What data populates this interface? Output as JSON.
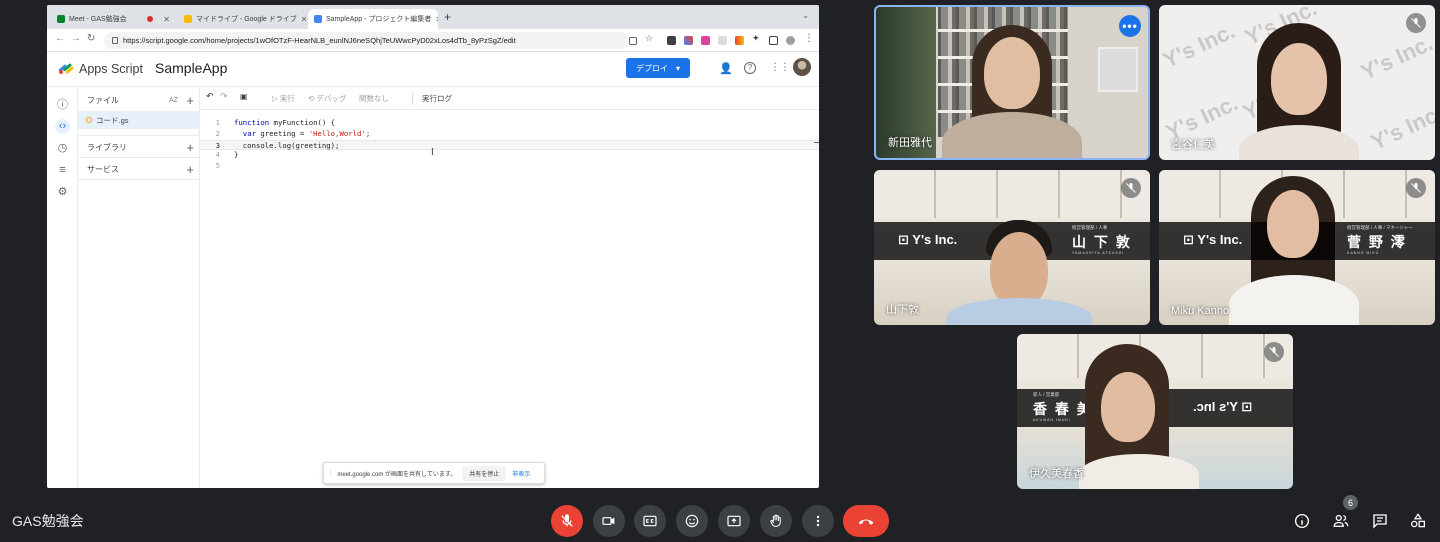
{
  "browser": {
    "tabs": [
      {
        "title": "Meet - GAS勉強会",
        "color": "#00832d"
      },
      {
        "title": "マイドライブ - Google ドライブ",
        "color": "#fbbc04"
      },
      {
        "title": "SampleApp - プロジェクト編集者",
        "color": "#4285f4"
      }
    ],
    "url": "https://script.google.com/home/projects/1wOfOTzF-HearNLB_eunlNJ6neSQhjTeUWwcPyD02xLos4dTb_8yPzSgZ/edit"
  },
  "apps_script": {
    "product_name": "Apps Script",
    "project_name": "SampleApp",
    "deploy_label": "デプロイ",
    "toolbar": {
      "run": "実行",
      "debug": "デバッグ",
      "function_select": "関数なし",
      "exec_log": "実行ログ"
    },
    "sidebar": {
      "files_label": "ファイル",
      "sort_label": "AZ",
      "active_file": "コード.gs",
      "libraries_label": "ライブラリ",
      "services_label": "サービス"
    },
    "code_lines": [
      {
        "num": "1",
        "parts": [
          {
            "t": "function",
            "c": "kw"
          },
          {
            "t": " myFunction() {",
            "c": ""
          }
        ]
      },
      {
        "num": "2",
        "parts": [
          {
            "t": "  ",
            "c": ""
          },
          {
            "t": "var",
            "c": "kw"
          },
          {
            "t": " greeting = ",
            "c": ""
          },
          {
            "t": "'Hello,World'",
            "c": "str"
          },
          {
            "t": ";",
            "c": ""
          }
        ]
      },
      {
        "num": "3",
        "parts": [
          {
            "t": "  console.log(greeting);",
            "c": ""
          }
        ]
      },
      {
        "num": "4",
        "parts": [
          {
            "t": "}",
            "c": ""
          }
        ]
      },
      {
        "num": "5",
        "parts": [
          {
            "t": "",
            "c": ""
          }
        ]
      }
    ]
  },
  "share_bar": {
    "message": "meet.google.com が画面を共有しています。",
    "stop_label": "共有を停止",
    "hide_label": "非表示"
  },
  "participants": [
    {
      "name": "新田雅代"
    },
    {
      "name": "宮谷仁美"
    },
    {
      "name": "山下敦",
      "company": "Y's Inc.",
      "role": "経営管理部 / 人事",
      "display_name": "山 下  敦",
      "roman": "YAMASHITA ATSUSHI"
    },
    {
      "name": "Miku Kanno",
      "company": "Y's Inc.",
      "role": "経営管理部 / 人事 / マネージャー",
      "display_name": "菅 野  澪",
      "roman": "KANNO MIKU"
    },
    {
      "name": "伊久美春香",
      "company": "Y's Inc.",
      "role": "新人 / 営業部",
      "display_name": "香 春  美 久",
      "roman": "AKUMAH IMUKI"
    }
  ],
  "watermark_text": "Y's Inc.",
  "meeting": {
    "title": "GAS勉強会",
    "participant_count": "6"
  },
  "colors": {
    "accent": "#1a73e8",
    "danger": "#ea4335",
    "control_bg": "#3c4043",
    "background": "#202124"
  }
}
